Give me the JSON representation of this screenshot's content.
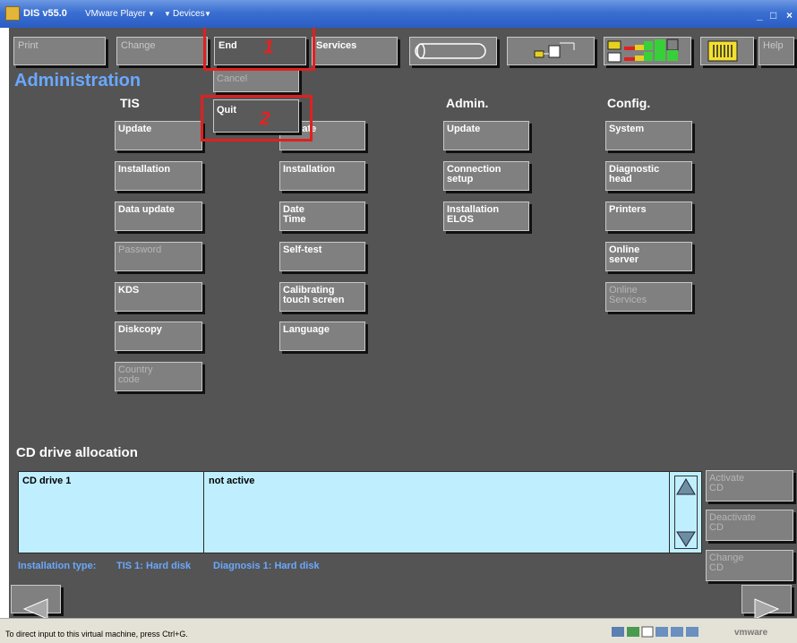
{
  "window": {
    "title": "DIS v55.0",
    "menu": [
      "VMware Player",
      "Devices"
    ],
    "min": "_",
    "max": "□",
    "close": "×"
  },
  "toolbar": {
    "print": "Print",
    "change": "Change",
    "end": "End",
    "services": "Services",
    "help": "Help"
  },
  "dropdown": {
    "cancel": "Cancel",
    "quit": "Quit"
  },
  "annotations": [
    "1",
    "2"
  ],
  "page_title": "Administration",
  "columns": {
    "tis": {
      "heading": "TIS",
      "items": [
        "Update",
        "Installation",
        "Data update",
        "Password",
        "KDS",
        "Diskcopy",
        "Country\ncode"
      ],
      "disabled": [
        false,
        false,
        false,
        true,
        false,
        false,
        true
      ]
    },
    "col2": {
      "heading": "",
      "items": [
        "Update",
        "Installation",
        "Date\nTime",
        "Self-test",
        "Calibrating\ntouch screen",
        "Language"
      ],
      "disabled": [
        false,
        false,
        false,
        false,
        false,
        false
      ]
    },
    "admin": {
      "heading": "Admin.",
      "items": [
        "Update",
        "Connection\nsetup",
        "Installation\nELOS"
      ],
      "disabled": [
        false,
        false,
        false
      ]
    },
    "config": {
      "heading": "Config.",
      "items": [
        "System",
        "Diagnostic\nhead",
        "Printers",
        "Online\nserver",
        "Online\nServices"
      ],
      "disabled": [
        false,
        false,
        false,
        false,
        true
      ]
    }
  },
  "cd": {
    "heading": "CD drive allocation",
    "rows": [
      {
        "drive": "CD drive 1",
        "status": "not active"
      }
    ],
    "activate": "Activate\nCD",
    "deactivate": "Deactivate\nCD",
    "change": "Change\nCD"
  },
  "installation": {
    "label": "Installation type:",
    "tis": "TIS 1: Hard disk",
    "diagnosis": "Diagnosis 1: Hard disk"
  },
  "statusbar": {
    "hint": "To direct input to this virtual machine, press Ctrl+G.",
    "brand": "vmware"
  },
  "colors": {
    "background": "#545454",
    "button": "#808080",
    "accent_blue": "#6aa8ff",
    "annotation_red": "#e02020",
    "table_bg": "#bfefff"
  }
}
